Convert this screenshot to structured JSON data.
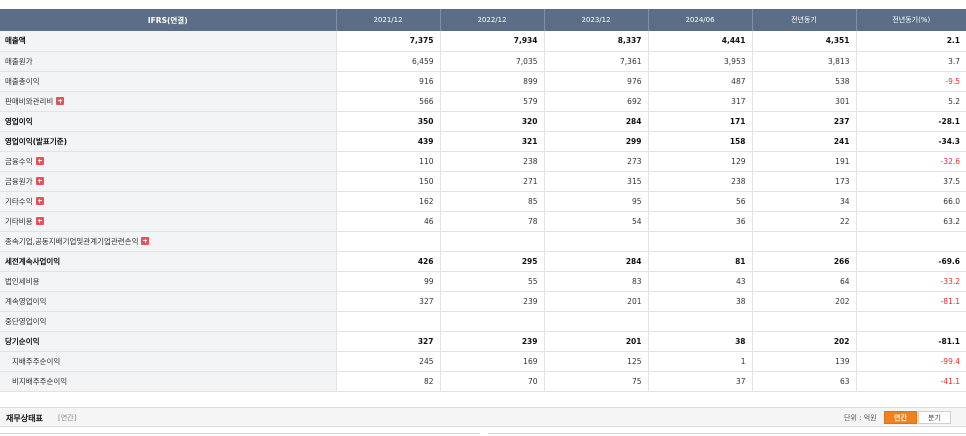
{
  "table": {
    "headers": [
      "IFRS(연결)",
      "2021/12",
      "2022/12",
      "2023/12",
      "2024/06",
      "전년동기",
      "전년동기(%)"
    ],
    "rows": [
      {
        "label": "매출액",
        "values": [
          "7,375",
          "7,934",
          "8,337",
          "4,441",
          "4,351",
          "2.1"
        ],
        "bold": true,
        "expand": false,
        "sub": false,
        "neg": false
      },
      {
        "label": "매출원가",
        "values": [
          "6,459",
          "7,035",
          "7,361",
          "3,953",
          "3,813",
          "3.7"
        ],
        "bold": false,
        "expand": false,
        "sub": false,
        "neg": false
      },
      {
        "label": "매출총이익",
        "values": [
          "916",
          "899",
          "976",
          "487",
          "538",
          "-9.5"
        ],
        "bold": false,
        "expand": false,
        "sub": false,
        "neg": true
      },
      {
        "label": "판매비와관리비",
        "values": [
          "566",
          "579",
          "692",
          "317",
          "301",
          "5.2"
        ],
        "bold": false,
        "expand": true,
        "sub": false,
        "neg": false
      },
      {
        "label": "영업이익",
        "values": [
          "350",
          "320",
          "284",
          "171",
          "237",
          "-28.1"
        ],
        "bold": true,
        "expand": false,
        "sub": false,
        "neg": true
      },
      {
        "label": "영업이익(발표기준)",
        "values": [
          "439",
          "321",
          "299",
          "158",
          "241",
          "-34.3"
        ],
        "bold": true,
        "expand": false,
        "sub": false,
        "neg": true
      },
      {
        "label": "금융수익",
        "values": [
          "110",
          "238",
          "273",
          "129",
          "191",
          "-32.6"
        ],
        "bold": false,
        "expand": true,
        "sub": false,
        "neg": true
      },
      {
        "label": "금융원가",
        "values": [
          "150",
          "271",
          "315",
          "238",
          "173",
          "37.5"
        ],
        "bold": false,
        "expand": true,
        "sub": false,
        "neg": false
      },
      {
        "label": "기타수익",
        "values": [
          "162",
          "85",
          "95",
          "56",
          "34",
          "66.0"
        ],
        "bold": false,
        "expand": true,
        "sub": false,
        "neg": false
      },
      {
        "label": "기타비용",
        "values": [
          "46",
          "78",
          "54",
          "36",
          "22",
          "63.2"
        ],
        "bold": false,
        "expand": true,
        "sub": false,
        "neg": false
      },
      {
        "label": "종속기업,공동지배기업및관계기업관련손익",
        "values": [
          "",
          "",
          "",
          "",
          "",
          ""
        ],
        "bold": false,
        "expand": true,
        "sub": false,
        "neg": false
      },
      {
        "label": "세전계속사업이익",
        "values": [
          "426",
          "295",
          "284",
          "81",
          "266",
          "-69.6"
        ],
        "bold": true,
        "expand": false,
        "sub": false,
        "neg": true
      },
      {
        "label": "법인세비용",
        "values": [
          "99",
          "55",
          "83",
          "43",
          "64",
          "-33.2"
        ],
        "bold": false,
        "expand": false,
        "sub": false,
        "neg": true
      },
      {
        "label": "계속영업이익",
        "values": [
          "327",
          "239",
          "201",
          "38",
          "202",
          "-81.1"
        ],
        "bold": false,
        "expand": false,
        "sub": false,
        "neg": true
      },
      {
        "label": "중단영업이익",
        "values": [
          "",
          "",
          "",
          "",
          "",
          ""
        ],
        "bold": false,
        "expand": false,
        "sub": false,
        "neg": false
      },
      {
        "label": "당기순이익",
        "values": [
          "327",
          "239",
          "201",
          "38",
          "202",
          "-81.1"
        ],
        "bold": true,
        "expand": false,
        "sub": false,
        "neg": true
      },
      {
        "label": "지배주주순이익",
        "values": [
          "245",
          "169",
          "125",
          "1",
          "139",
          "-99.4"
        ],
        "bold": false,
        "expand": false,
        "sub": true,
        "neg": true
      },
      {
        "label": "비지배주주순이익",
        "values": [
          "82",
          "70",
          "75",
          "37",
          "63",
          "-41.1"
        ],
        "bold": false,
        "expand": false,
        "sub": true,
        "neg": true
      }
    ]
  },
  "section": {
    "title": "재무상태표",
    "subtitle": "[연간]",
    "unit": "단위 : 억원",
    "annual_label": "연간",
    "quarter_label": "분기"
  },
  "colors": {
    "header_bg": "#5b6d87",
    "negative": "#e0302b",
    "accent_orange": "#f0821e",
    "expand_icon": "#e8505b"
  },
  "icons": {
    "expand": "plus-square-icon"
  }
}
